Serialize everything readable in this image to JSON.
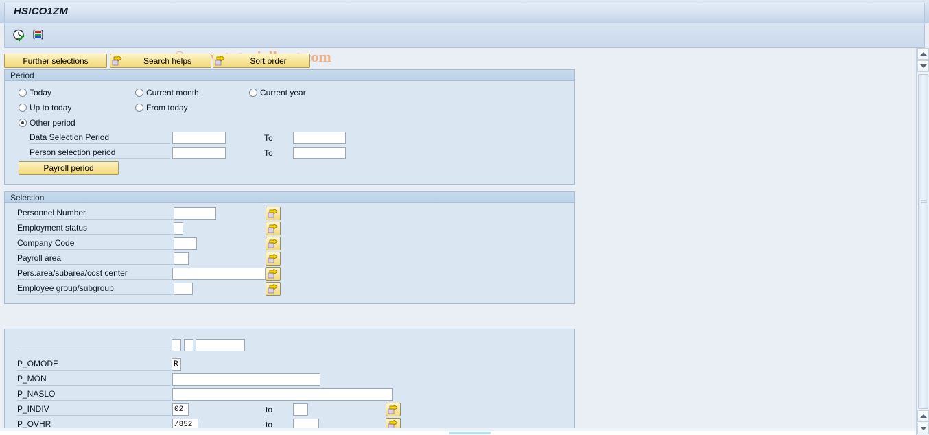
{
  "window": {
    "title": "HSICO1ZM",
    "watermark": "© www.tutorialkart.com"
  },
  "toolbar": {
    "execute_icon": "clock-check-icon",
    "chart_icon": "color-bars-icon"
  },
  "button_row": [
    {
      "label": "Further selections",
      "icon": null
    },
    {
      "label": "Search helps",
      "icon": "yellow-arrow-icon"
    },
    {
      "label": "Sort order",
      "icon": "yellow-arrow-icon"
    }
  ],
  "period": {
    "title": "Period",
    "radios": [
      {
        "label": "Today",
        "selected": false
      },
      {
        "label": "Current month",
        "selected": false
      },
      {
        "label": "Current year",
        "selected": false
      },
      {
        "label": "Up to today",
        "selected": false
      },
      {
        "label": "From today",
        "selected": false
      },
      {
        "label": "Other period",
        "selected": true
      }
    ],
    "fields": [
      {
        "label": "Data Selection Period",
        "value": "",
        "to_label": "To",
        "to_value": ""
      },
      {
        "label": "Person selection period",
        "value": "",
        "to_label": "To",
        "to_value": ""
      }
    ],
    "payroll_button": "Payroll period"
  },
  "selection": {
    "title": "Selection",
    "rows": [
      {
        "label": "Personnel Number",
        "value": ""
      },
      {
        "label": "Employment status",
        "value": ""
      },
      {
        "label": "Company Code",
        "value": ""
      },
      {
        "label": "Payroll area",
        "value": ""
      },
      {
        "label": "Pers.area/subarea/cost center",
        "value": ""
      },
      {
        "label": "Employee group/subgroup",
        "value": ""
      }
    ]
  },
  "parameters": {
    "title": "",
    "top_row": {
      "small1": "",
      "small2": "",
      "wide": ""
    },
    "rows": [
      {
        "label": "P_OMODE",
        "value": "R",
        "to_label": "",
        "to_value": ""
      },
      {
        "label": "P_MON",
        "value": "",
        "to_label": "",
        "to_value": ""
      },
      {
        "label": "P_NASLO",
        "value": "",
        "to_label": "",
        "to_value": ""
      },
      {
        "label": "P_INDIV",
        "value": "02",
        "to_label": "to",
        "to_value": ""
      },
      {
        "label": "P_OVHR",
        "value": "/852",
        "to_label": "to",
        "to_value": ""
      }
    ]
  },
  "colors": {
    "accent_button": "#f7e59a",
    "panel_bg": "#dae6f2",
    "panel_border": "#a8bdd4",
    "watermark": "#f0b183",
    "window_bg": "#eaeff5"
  }
}
